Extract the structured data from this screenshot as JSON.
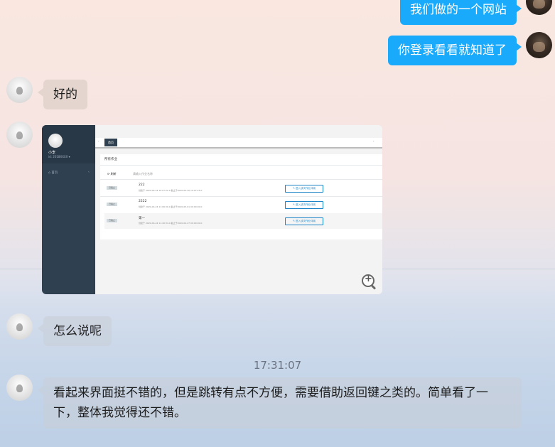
{
  "messages": {
    "m1": "我们做的一个网站",
    "m2": "你登录看看就知道了",
    "m3": "好的",
    "m4": "怎么说呢",
    "timestamp": "17:31:07",
    "m5": "看起来界面挺不错的，但是跳转有点不方便，需要借助返回键之类的。简单看了一下，整体我觉得还不错。"
  },
  "shot": {
    "user_name": "小李",
    "user_role": "id: 2018XXXX ▾",
    "nav_label": "⌂ 首页",
    "nav_arrow": "‹",
    "tab_label": "首页",
    "tab_arrow_left": "‹",
    "tab_arrow_right": "›",
    "panel_title": "所有作业",
    "search_label": "⟳ 刷新",
    "search_placeholder": "请输入作业名称",
    "rows": [
      {
        "badge": "已截止",
        "name": "222",
        "desc": "创建于 2020-04-24 10:07:22.0 截止于2020-04-30 10:07:25.0",
        "button": "✎ 进入该次作业评阅"
      },
      {
        "badge": "已截止",
        "name": "2222",
        "desc": "创建于 2020-04-24 11:06:39.0 截止于2020-05-01 00:00:00.0",
        "button": "✎ 进入该次作业评阅"
      },
      {
        "badge": "已截止",
        "name": "第一",
        "desc": "创建于 2020-04-24 11:40:34.0 截止于2020-04-27 00:00:00.0",
        "button": "✎ 进入该次作业评阅"
      }
    ]
  },
  "icons": {
    "zoom": "zoom-in-icon"
  },
  "colors": {
    "outgoing_bubble": "#1aaafb",
    "sidebar": "#2f4050"
  }
}
